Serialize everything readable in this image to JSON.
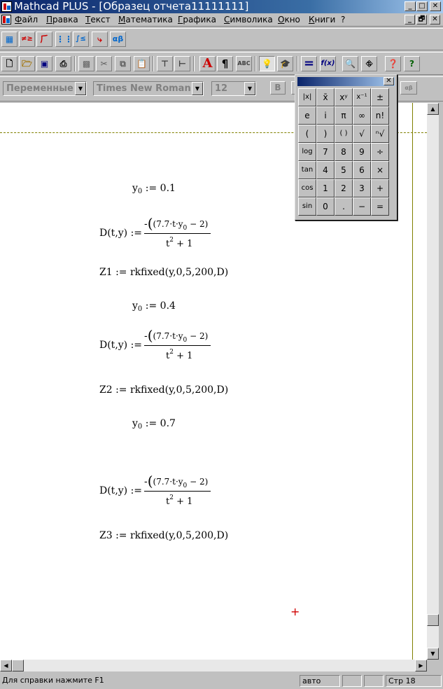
{
  "window": {
    "title": "Mathcad PLUS - [Образец  отчета11111111]",
    "buttons": {
      "minimize": "_",
      "maximize": "□",
      "close": "✕"
    }
  },
  "menubar": {
    "items": [
      "Файл",
      "Правка",
      "Текст",
      "Математика",
      "Графика",
      "Символика",
      "Окно",
      "Книги",
      "?"
    ],
    "doc_buttons": {
      "minimize": "_",
      "restore": "🗗",
      "close": "✕"
    }
  },
  "math_toolbar": {
    "icons": [
      "calculator-palette-icon",
      "evaluation-palette-icon",
      "graph-palette-icon",
      "matrix-palette-icon",
      "calculus-palette-icon",
      "programming-palette-icon",
      "greek-palette-icon"
    ],
    "labels": {
      "greek": "αβ",
      "neq": "≠≥",
      "integral": "∫≤"
    }
  },
  "standard_toolbar": {
    "text_icon": "A",
    "paragraph_icon": "¶",
    "spell_icon": "ABC",
    "equals": "=",
    "fx": "f(x)",
    "help": "?"
  },
  "format_toolbar": {
    "style": "Переменные",
    "font": "Times New Roman C",
    "size": "12",
    "bold": "B",
    "extra": "αβ"
  },
  "document": {
    "blocks": [
      {
        "var": "y",
        "sub": "0",
        "op": ":=",
        "value": "0.1"
      },
      {
        "func": "D(t,y)",
        "op": ":=",
        "num_pre": "-",
        "num": "(7.7·t·y",
        "num_sub": "0",
        "num_post": " − 2)",
        "den": "t",
        "den_sup": "2",
        "den_post": " + 1"
      },
      {
        "text": "Z1 := rkfixed(y,0,5,200,D)"
      },
      {
        "var": "y",
        "sub": "0",
        "op": ":=",
        "value": "0.4"
      },
      {
        "func": "D(t,y)",
        "op": ":=",
        "num_pre": "-",
        "num": "(7.7·t·y",
        "num_sub": "0",
        "num_post": " − 2)",
        "den": "t",
        "den_sup": "2",
        "den_post": " + 1"
      },
      {
        "text": "Z2 := rkfixed(y,0,5,200,D)"
      },
      {
        "var": "y",
        "sub": "0",
        "op": ":=",
        "value": "0.7"
      },
      {
        "func": "D(t,y)",
        "op": ":=",
        "num_pre": "-",
        "num": "(7.7·t·y",
        "num_sub": "0",
        "num_post": " − 2)",
        "den": "t",
        "den_sup": "2",
        "den_post": " + 1"
      },
      {
        "text": "Z3 := rkfixed(y,0,5,200,D)"
      }
    ],
    "cursor": "+"
  },
  "palette": {
    "title": "",
    "close": "✕",
    "keys": [
      "|x|",
      "x̄",
      "xʸ",
      "x⁻¹",
      "±",
      "e",
      "i",
      "π",
      "∞",
      "n!",
      "(",
      ")",
      "( )",
      "√",
      "ⁿ√",
      "log",
      "7",
      "8",
      "9",
      "÷",
      "tan",
      "4",
      "5",
      "6",
      "×",
      "cos",
      "1",
      "2",
      "3",
      "+",
      "sin",
      "0",
      ".",
      "−",
      "="
    ]
  },
  "status": {
    "help": "Для справки нажмите F1",
    "mode": "авто",
    "page": "Стр 18"
  }
}
